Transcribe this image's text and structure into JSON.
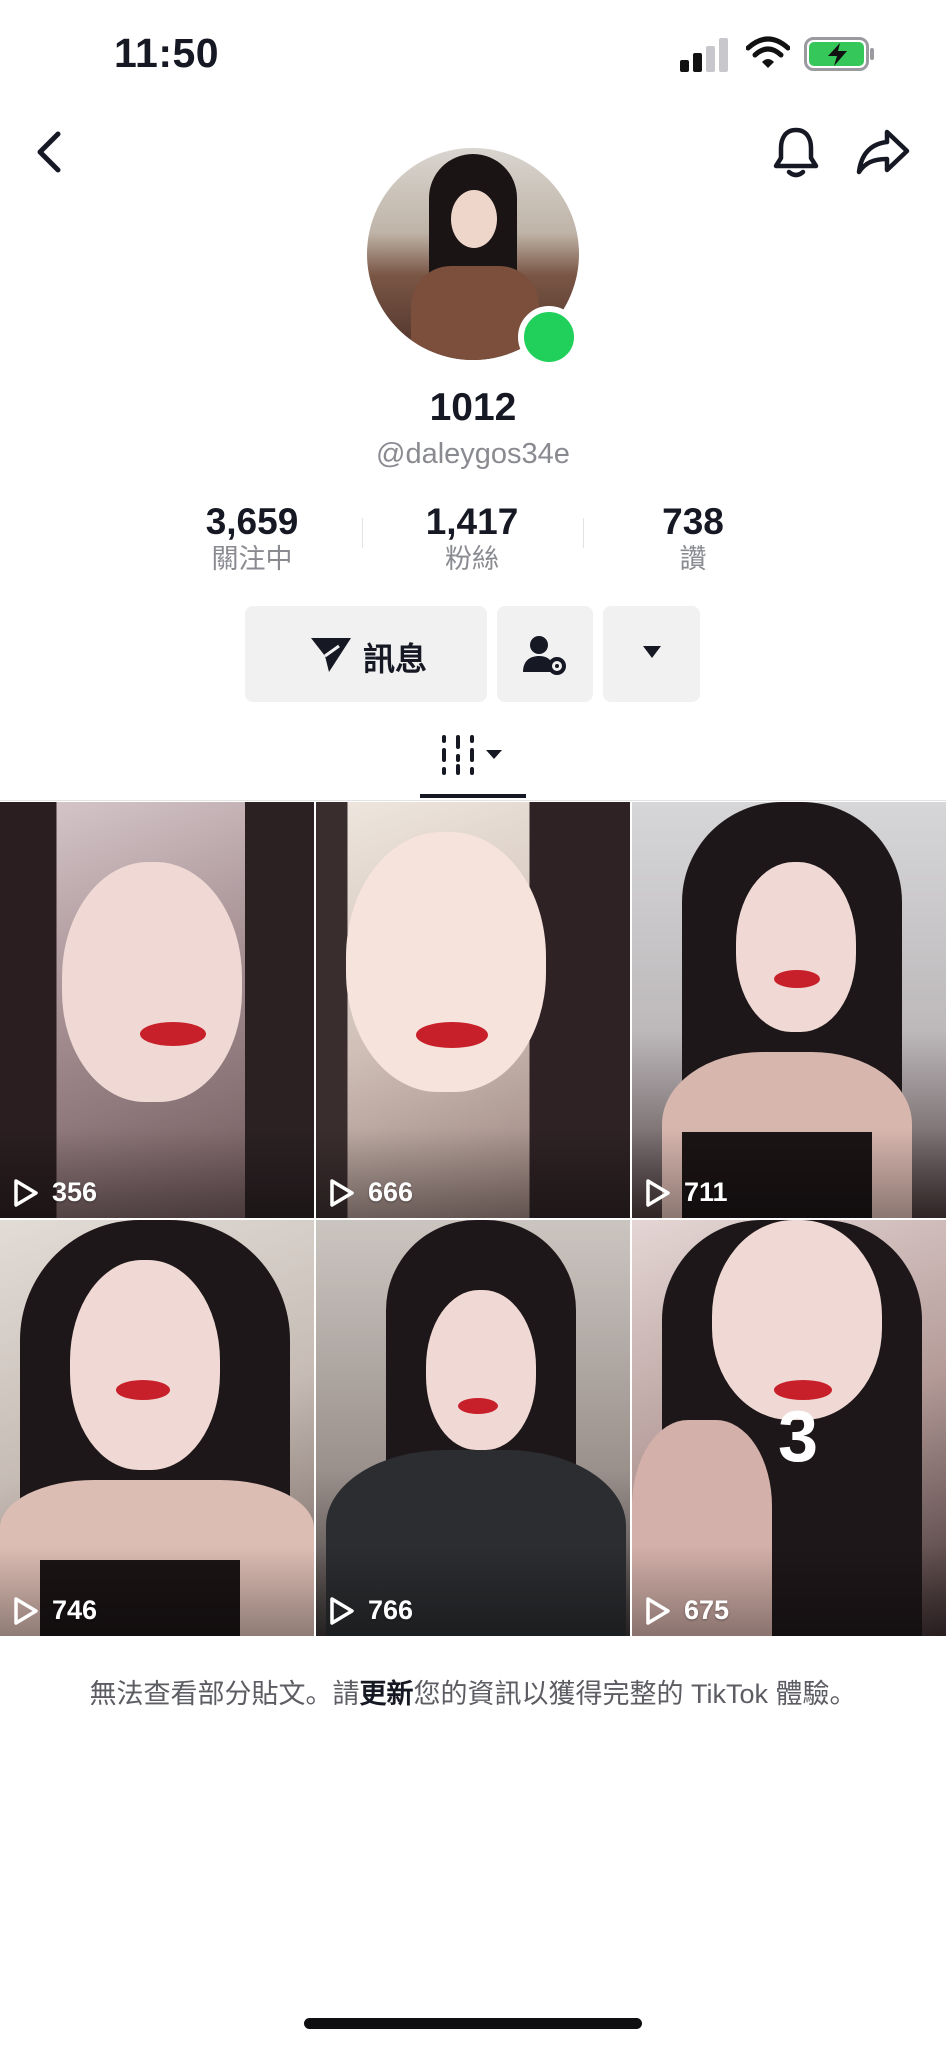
{
  "status_bar": {
    "time": "11:50",
    "icons": [
      "signal-icon",
      "wifi-icon",
      "battery-charging-icon"
    ],
    "battery_color": "#35c759"
  },
  "nav": {
    "icons": [
      "back-chevron-icon",
      "bell-icon",
      "share-icon"
    ]
  },
  "profile": {
    "display_name": "1012",
    "username": "@daleygos34e",
    "online_color": "#20d05b"
  },
  "stats": [
    {
      "value": "3,659",
      "label": "關注中"
    },
    {
      "value": "1,417",
      "label": "粉絲"
    },
    {
      "value": "738",
      "label": "讚"
    }
  ],
  "actions": {
    "message_label": "訊息",
    "icons": [
      "send-icon",
      "person-gear-icon",
      "caret-down-icon"
    ]
  },
  "tabs": {
    "icon": "videos-grid-icon"
  },
  "videos": [
    {
      "views": "356",
      "overlay_text": ""
    },
    {
      "views": "666",
      "overlay_text": ""
    },
    {
      "views": "711",
      "overlay_text": ""
    },
    {
      "views": "746",
      "overlay_text": ""
    },
    {
      "views": "766",
      "overlay_text": ""
    },
    {
      "views": "675",
      "overlay_text": "3"
    }
  ],
  "notice": {
    "before": "無法查看部分貼文。請",
    "link": "更新",
    "after": "您的資訊以獲得完整的 TikTok 體驗。"
  }
}
